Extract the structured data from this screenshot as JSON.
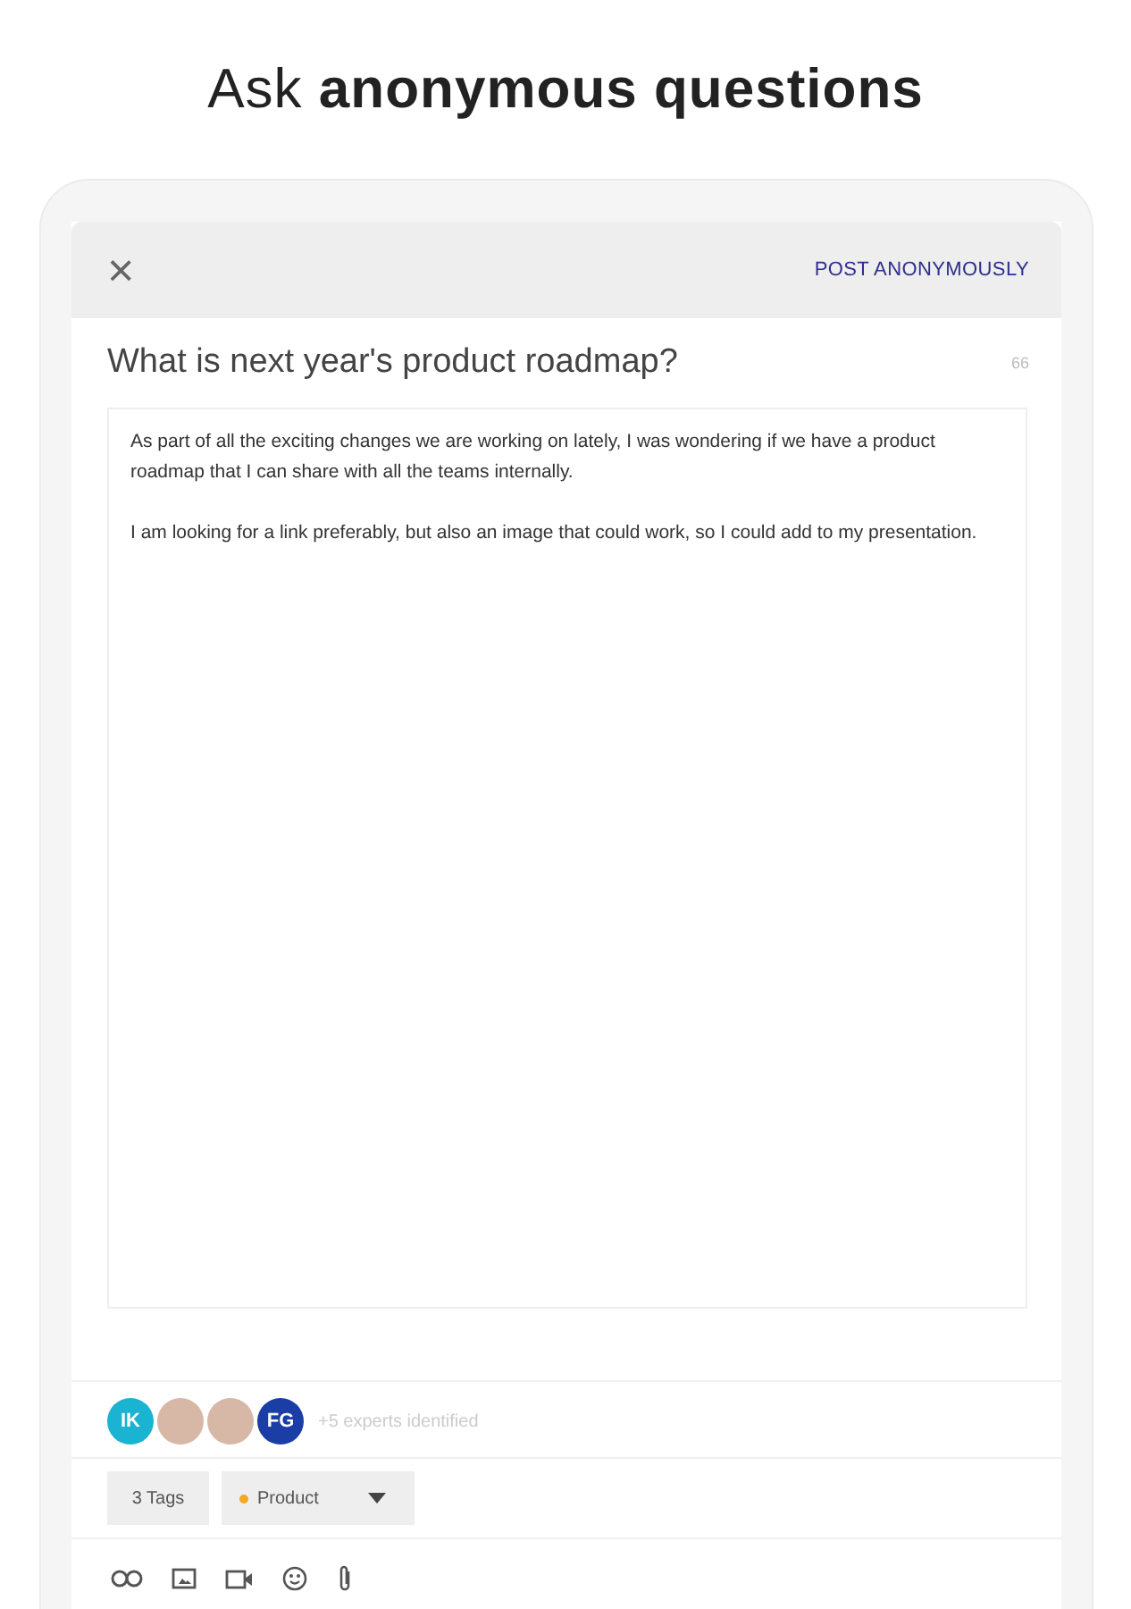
{
  "headline": "Ask **anonymous questions**",
  "header": {
    "close_icon": "×",
    "action": "POST ANONYMOUSLY"
  },
  "question": {
    "title": "What is next year's product roadmap?",
    "counter": "66"
  },
  "body": [
    "As part of all the exciting changes we are working on lately, I was wondering if we have a product roadmap that I can share with all the teams internally.",
    "I am looking for a link preferably, but also an image that could work, so I could add to my presentation."
  ],
  "experts": {
    "avatars": [
      {
        "kind": "initials",
        "text": "IK",
        "color": "#1ab3d1"
      },
      {
        "kind": "photo"
      },
      {
        "kind": "photo"
      },
      {
        "kind": "initials",
        "text": "FG",
        "color": "#1a3da6"
      }
    ],
    "note": "+5 experts identified"
  },
  "tags": {
    "count": "3 Tags",
    "selected": {
      "label": "Product",
      "color": "#f5a623"
    }
  },
  "toolbar": [
    {
      "kind": "link"
    },
    {
      "kind": "image"
    },
    {
      "kind": "video"
    },
    {
      "kind": "emoji"
    },
    {
      "kind": "attach"
    }
  ]
}
